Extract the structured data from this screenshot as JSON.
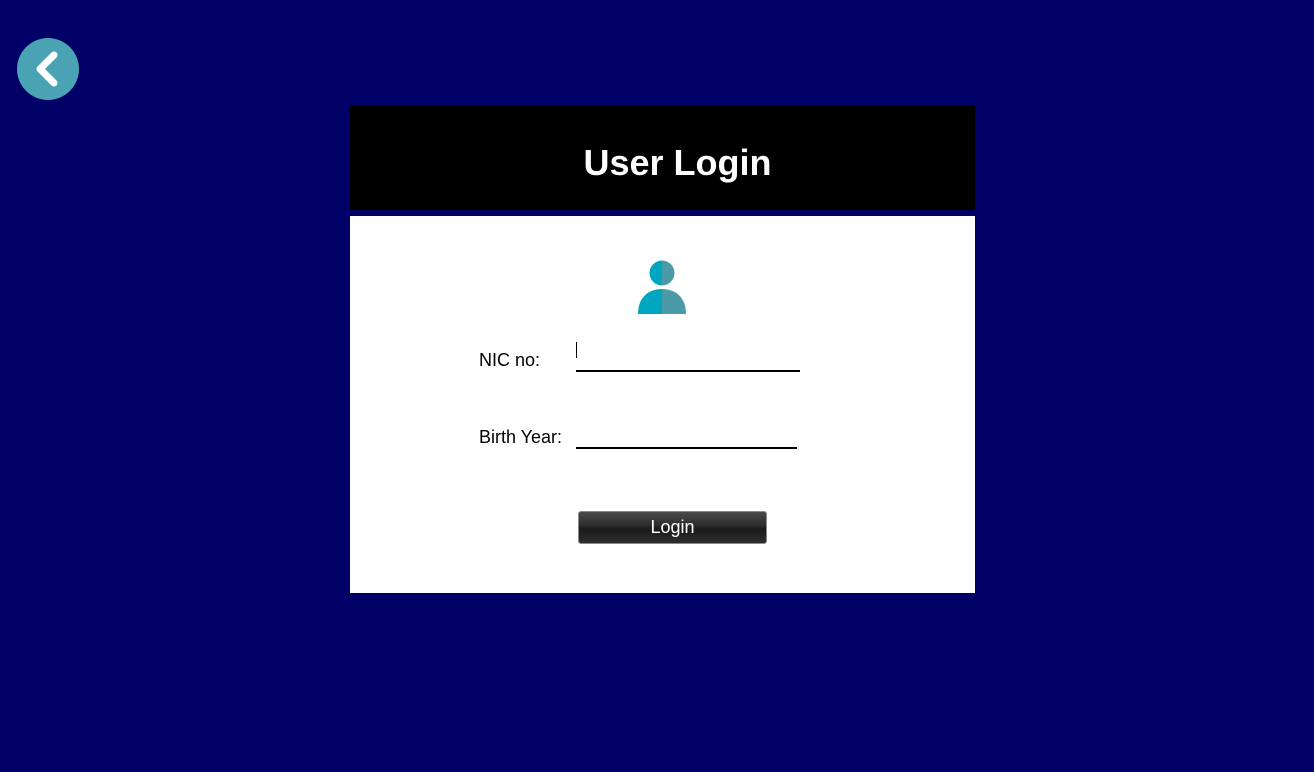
{
  "colors": {
    "background": "#000066",
    "header_bg": "#000000",
    "panel_bg": "#ffffff",
    "accent": "#4aa3b3",
    "icon_primary": "#00a6bf",
    "icon_secondary": "#4a9aa8"
  },
  "nav": {
    "back_icon": "chevron-left-icon"
  },
  "header": {
    "title": "User Login"
  },
  "form": {
    "avatar_icon": "user-icon",
    "nic": {
      "label": "NIC no:",
      "value": ""
    },
    "birth_year": {
      "label": "Birth Year:",
      "value": ""
    },
    "login_label": "Login"
  }
}
